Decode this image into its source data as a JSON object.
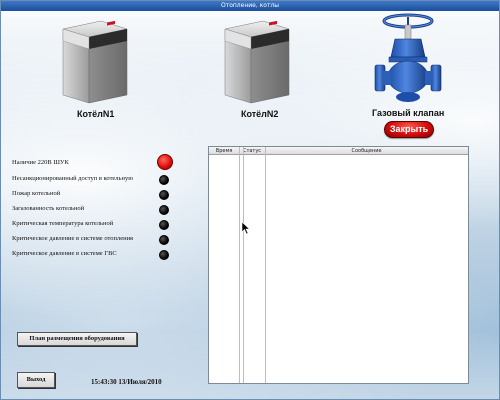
{
  "window": {
    "title": "Отопление, котлы"
  },
  "boilers": [
    {
      "label": "КотёлN1"
    },
    {
      "label": "КотёлN2"
    }
  ],
  "valve": {
    "label": "Газовый клапан",
    "close_label": "Закрыть"
  },
  "status_items": [
    {
      "label": "Наличие 220В ШУК",
      "state": "alarm"
    },
    {
      "label": "Несанкционированный доступ в котельную",
      "state": "off"
    },
    {
      "label": "Пожар котельной",
      "state": "off"
    },
    {
      "label": "Загазованность котельной",
      "state": "off"
    },
    {
      "label": "Критическая температура котельной",
      "state": "off"
    },
    {
      "label": "Критическое давление в системе отопления",
      "state": "off"
    },
    {
      "label": "Критическое давление в системе ГВС",
      "state": "off"
    }
  ],
  "log": {
    "columns": [
      "Время",
      "Статус",
      "Сообщение"
    ],
    "rows": []
  },
  "buttons": {
    "equipment_plan": "План размещения оборудования",
    "exit": "Выход"
  },
  "clock": "15:43:30 13/Июля/2010",
  "colors": {
    "alarm": "#e01010",
    "off": "#000000",
    "title_bar": "#1b4f9c"
  }
}
